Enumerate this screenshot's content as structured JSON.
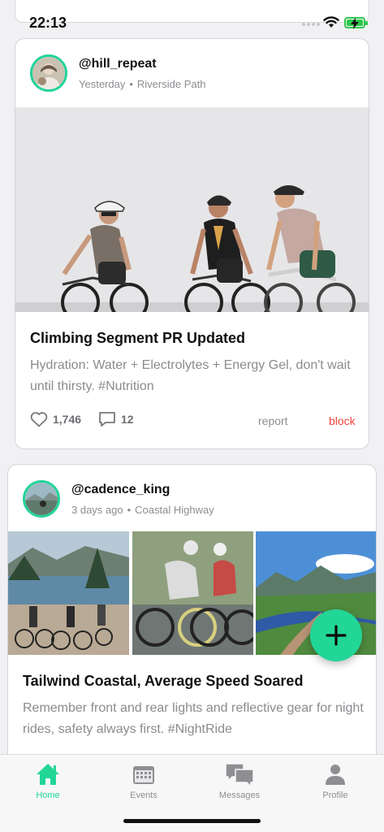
{
  "status_bar": {
    "time": "22:13"
  },
  "posts": [
    {
      "username": "@hill_repeat",
      "when": "Yesterday",
      "location": "Riverside Path",
      "title": "Climbing Segment PR Updated",
      "body": "Hydration: Water + Electrolytes + Energy Gel, don't wait until thirsty. #Nutrition",
      "likes": "1,746",
      "comments": "12",
      "report_label": "report",
      "block_label": "block"
    },
    {
      "username": "@cadence_king",
      "when": "3 days ago",
      "location": "Coastal Highway",
      "title": "Tailwind Coastal, Average Speed Soared",
      "body": "Remember front and rear lights and reflective gear for night rides, safety always first. #NightRide"
    }
  ],
  "fab": {
    "icon": "plus-icon"
  },
  "tabs": [
    {
      "label": "Home",
      "icon": "home-icon",
      "active": true
    },
    {
      "label": "Events",
      "icon": "calendar-icon",
      "active": false
    },
    {
      "label": "Messages",
      "icon": "chat-bubbles-icon",
      "active": false
    },
    {
      "label": "Profile",
      "icon": "person-icon",
      "active": false
    }
  ],
  "colors": {
    "accent": "#22d697",
    "block": "#f0443a",
    "avatar_ring": "#23d39a"
  }
}
